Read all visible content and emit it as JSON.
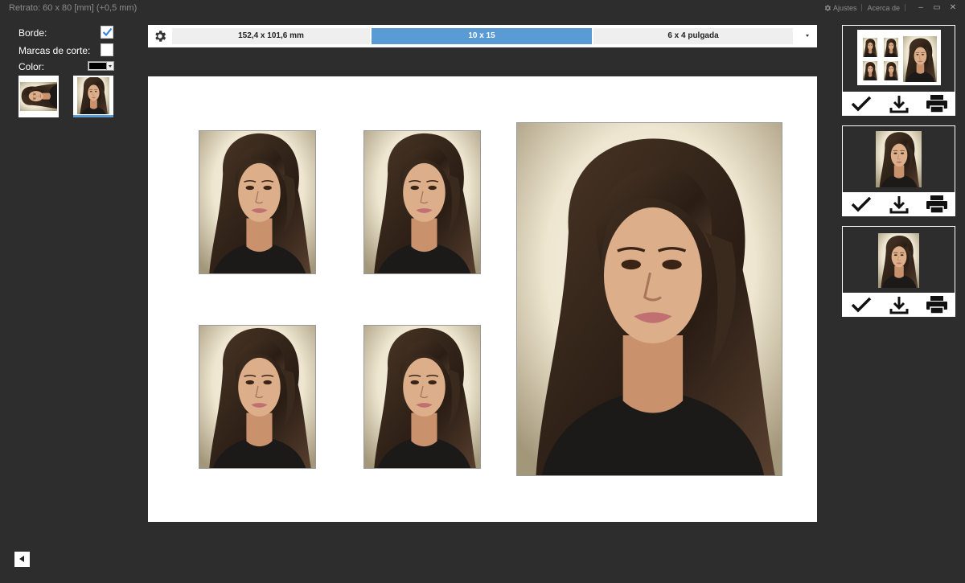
{
  "window": {
    "title": "Retrato: 60 x 80 [mm] (+0,5 mm)",
    "settings_label": "Ajustes",
    "about_label": "Acerca de",
    "minimize_glyph": "–",
    "maximize_glyph": "▭",
    "close_glyph": "✕"
  },
  "options": {
    "border_label": "Borde:",
    "border_checked": true,
    "cut_marks_label": "Marcas de corte:",
    "cut_marks_checked": false,
    "color_label": "Color:",
    "color_value": "#000000"
  },
  "orientation_thumbs": [
    {
      "name": "landscape",
      "selected": false
    },
    {
      "name": "portrait",
      "selected": true
    }
  ],
  "paper_sizes": {
    "options": [
      "152,4 x 101,6 mm",
      "10 x 15",
      "6 x 4 pulgada"
    ],
    "selected": "10 x 15"
  },
  "sheet": {
    "layout": "4 small passport photos + 1 large portrait"
  },
  "presets": [
    {
      "name": "sheet-layout",
      "actions": [
        "apply",
        "download",
        "print"
      ]
    },
    {
      "name": "single-photo",
      "actions": [
        "apply",
        "download",
        "print"
      ]
    },
    {
      "name": "single-photo-small",
      "actions": [
        "apply",
        "download",
        "print"
      ]
    }
  ],
  "colors": {
    "background": "#2d2d2d",
    "accent": "#5b9bd5",
    "sheet": "#ffffff"
  }
}
